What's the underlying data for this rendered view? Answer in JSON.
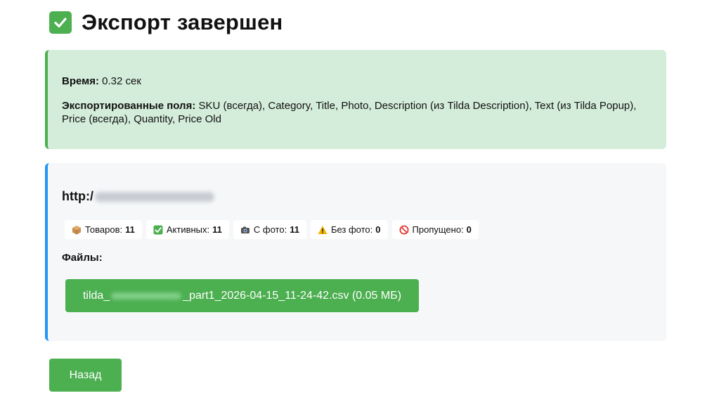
{
  "header": {
    "title": "Экспорт завершен",
    "icon": "check-mark-button-icon"
  },
  "summary": {
    "time_label": "Время:",
    "time_value": "0.32 сек",
    "fields_label": "Экспортированные поля:",
    "fields_value": "SKU (всегда), Category, Title, Photo, Description (из Tilda Description), Text (из Tilda Popup), Price (всегда), Quantity, Price Old"
  },
  "result": {
    "site_prefix": "http:/",
    "stats": [
      {
        "icon": "package-icon",
        "label": "Товаров:",
        "value": "11"
      },
      {
        "icon": "check-mark-icon",
        "label": "Активных:",
        "value": "11"
      },
      {
        "icon": "camera-icon",
        "label": "С фото:",
        "value": "11"
      },
      {
        "icon": "warning-icon",
        "label": "Без фото:",
        "value": "0"
      },
      {
        "icon": "prohibited-icon",
        "label": "Пропущено:",
        "value": "0"
      }
    ],
    "files_label": "Файлы:",
    "file": {
      "prefix": "tilda_",
      "suffix": "_part1_2026-04-15_11-24-42.csv (0.05 МБ)"
    }
  },
  "actions": {
    "back_label": "Назад"
  },
  "colors": {
    "accent_green": "#4caf50",
    "success_bg": "#d4edda",
    "info_border": "#2196f3",
    "card_bg": "#f5f7f9"
  }
}
